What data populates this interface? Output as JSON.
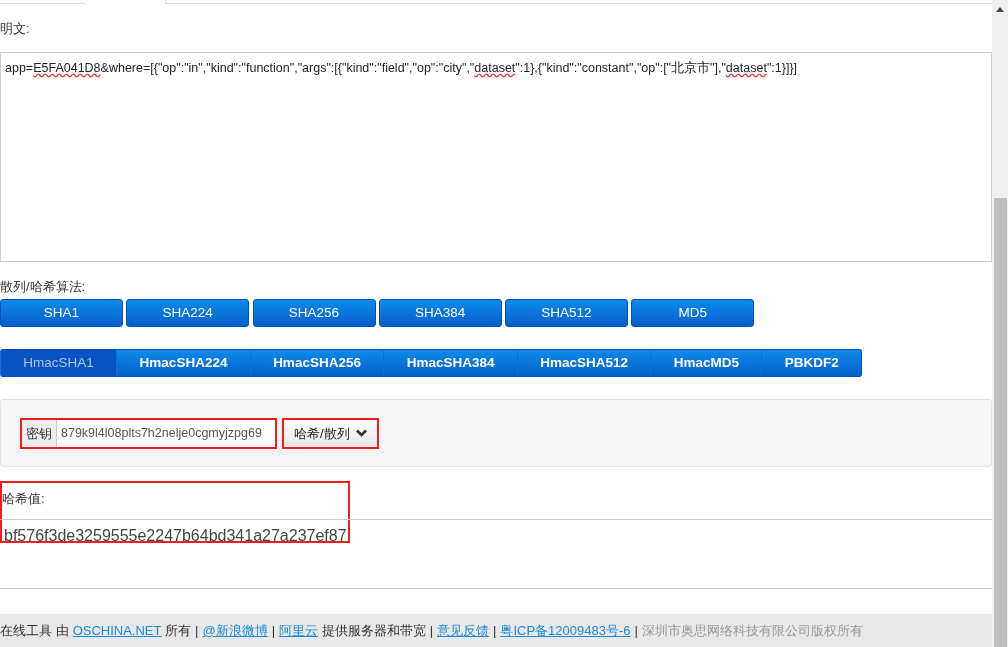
{
  "plaintext": {
    "label": "明文:",
    "value": "app=E5FA041D8&where=[{\"op\":\"in\",\"kind\":\"function\",\"args\":[{\"kind\":\"field\",\"op\":\"city\",\"dataset\":1},{\"kind\":\"constant\",\"op\":[\"北京市\"],\"dataset\":1}]}]"
  },
  "hash_label": "散列/哈希算法:",
  "hash_buttons": [
    "SHA1",
    "SHA224",
    "SHA256",
    "SHA384",
    "SHA512",
    "MD5"
  ],
  "hmac_tabs": [
    {
      "label": "HmacSHA1",
      "selected": true
    },
    {
      "label": "HmacSHA224",
      "selected": false
    },
    {
      "label": "HmacSHA256",
      "selected": false
    },
    {
      "label": "HmacSHA384",
      "selected": false
    },
    {
      "label": "HmacSHA512",
      "selected": false
    },
    {
      "label": "HmacMD5",
      "selected": false
    },
    {
      "label": "PBKDF2",
      "selected": false
    }
  ],
  "key": {
    "label": "密钥",
    "value": "879k9l4l08plts7h2nelje0cgmyjzpg69"
  },
  "hash_dropdown": "哈希/散列",
  "result": {
    "label": "哈希值:",
    "value": "bf576f3de3259555e2247b64bd341a27a237ef87"
  },
  "footer": [
    {
      "text": "在线工具 由",
      "kind": "text"
    },
    {
      "text": "OSCHINA.NET",
      "kind": "link"
    },
    {
      "text": "所有 |",
      "kind": "text"
    },
    {
      "text": "@新浪微博",
      "kind": "link"
    },
    {
      "text": "|",
      "kind": "text"
    },
    {
      "text": "阿里云",
      "kind": "link"
    },
    {
      "text": "提供服务器和带宽 |",
      "kind": "text"
    },
    {
      "text": "意见反馈",
      "kind": "link"
    },
    {
      "text": "|",
      "kind": "text"
    },
    {
      "text": "粤ICP备12009483号-6",
      "kind": "link"
    },
    {
      "text": "|",
      "kind": "text"
    },
    {
      "text": "深圳市奥思网络科技有限公司版权所有",
      "kind": "muted"
    }
  ]
}
